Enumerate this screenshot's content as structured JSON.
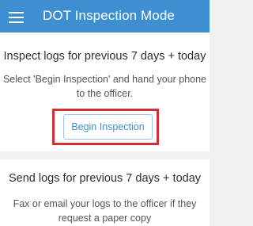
{
  "header": {
    "title": "DOT Inspection Mode",
    "menu_icon": "hamburger-menu-icon",
    "background_color": "#3d8fd1"
  },
  "inspect": {
    "title": "Inspect logs for previous 7 days + today",
    "description": "Select 'Begin Inspection' and hand your phone to the officer.",
    "button_label": "Begin Inspection",
    "highlight_color": "#d32f38"
  },
  "send": {
    "title": "Send logs for previous 7 days + today",
    "description": "Fax or email your logs to the officer if they request a paper copy"
  }
}
